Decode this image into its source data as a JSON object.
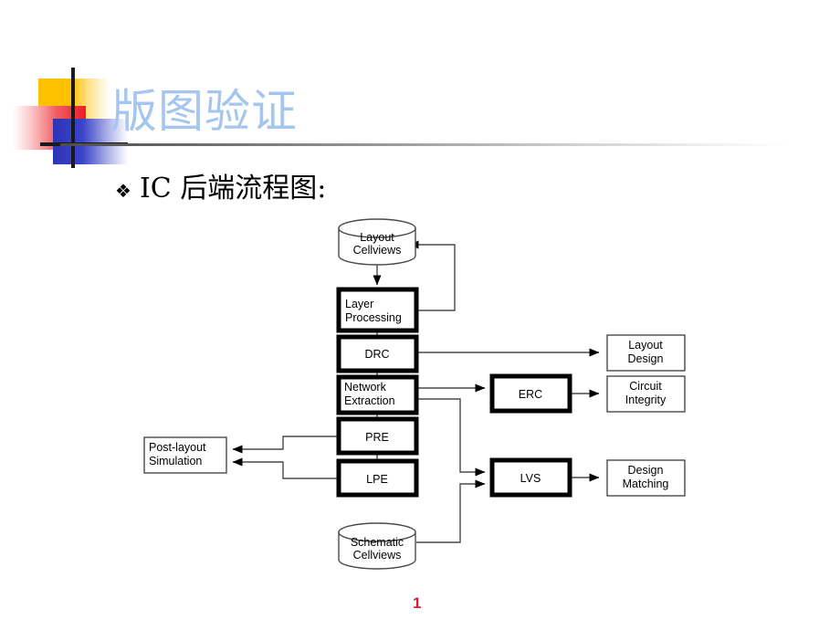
{
  "slide": {
    "title": "版图验证",
    "bullet_glyph": "❖",
    "bullet_text": "IC 后端流程图:",
    "page_number": "1",
    "colors": {
      "title_text": "#A5C6EE",
      "page_number": "#D91E3C",
      "deco_yellow": "#FFC000",
      "deco_red": "#ED1C24",
      "deco_blue": "#2B35B5",
      "diagram_stroke": "#000000"
    }
  },
  "diagram": {
    "type": "flowchart",
    "title": "IC backend verification flow",
    "nodes": [
      {
        "id": "layout_cellviews",
        "label_line1": "Layout",
        "label_line2": "Cellviews",
        "shape": "cylinder",
        "emphasis": "thin"
      },
      {
        "id": "layer_processing",
        "label_line1": "Layer",
        "label_line2": "Processing",
        "shape": "rect",
        "emphasis": "thick"
      },
      {
        "id": "drc",
        "label_line1": "DRC",
        "label_line2": "",
        "shape": "rect",
        "emphasis": "thick"
      },
      {
        "id": "network_extraction",
        "label_line1": "Network",
        "label_line2": "Extraction",
        "shape": "rect",
        "emphasis": "thick"
      },
      {
        "id": "pre",
        "label_line1": "PRE",
        "label_line2": "",
        "shape": "rect",
        "emphasis": "thick"
      },
      {
        "id": "lpe",
        "label_line1": "LPE",
        "label_line2": "",
        "shape": "rect",
        "emphasis": "thick"
      },
      {
        "id": "schematic_cellviews",
        "label_line1": "Schematic",
        "label_line2": "Cellviews",
        "shape": "cylinder",
        "emphasis": "thin"
      },
      {
        "id": "erc",
        "label_line1": "ERC",
        "label_line2": "",
        "shape": "rect",
        "emphasis": "thick"
      },
      {
        "id": "lvs",
        "label_line1": "LVS",
        "label_line2": "",
        "shape": "rect",
        "emphasis": "thick"
      },
      {
        "id": "layout_design",
        "label_line1": "Layout",
        "label_line2": "Design",
        "shape": "rect",
        "emphasis": "thin"
      },
      {
        "id": "circuit_integrity",
        "label_line1": "Circuit",
        "label_line2": "Integrity",
        "shape": "rect",
        "emphasis": "thin"
      },
      {
        "id": "design_matching",
        "label_line1": "Design",
        "label_line2": "Matching",
        "shape": "rect",
        "emphasis": "thin"
      },
      {
        "id": "post_layout_sim",
        "label_line1": "Post-layout",
        "label_line2": "Simulation",
        "shape": "rect",
        "emphasis": "thin"
      }
    ],
    "edges": [
      {
        "from": "layout_cellviews",
        "to": "layer_processing",
        "arrow": true
      },
      {
        "from": "layer_processing",
        "to": "layout_cellviews",
        "arrow": true,
        "style": "feedback"
      },
      {
        "from": "layer_processing",
        "to": "drc",
        "arrow": false
      },
      {
        "from": "drc",
        "to": "layout_design",
        "arrow": true
      },
      {
        "from": "drc",
        "to": "network_extraction",
        "arrow": false
      },
      {
        "from": "network_extraction",
        "to": "erc",
        "arrow": true
      },
      {
        "from": "erc",
        "to": "circuit_integrity",
        "arrow": true
      },
      {
        "from": "network_extraction",
        "to": "lvs",
        "arrow": true
      },
      {
        "from": "network_extraction",
        "to": "pre",
        "arrow": false
      },
      {
        "from": "pre",
        "to": "post_layout_sim",
        "arrow": true
      },
      {
        "from": "pre",
        "to": "lpe",
        "arrow": false
      },
      {
        "from": "lpe",
        "to": "post_layout_sim",
        "arrow": true
      },
      {
        "from": "schematic_cellviews",
        "to": "lvs",
        "arrow": true
      },
      {
        "from": "lvs",
        "to": "design_matching",
        "arrow": true
      }
    ]
  }
}
